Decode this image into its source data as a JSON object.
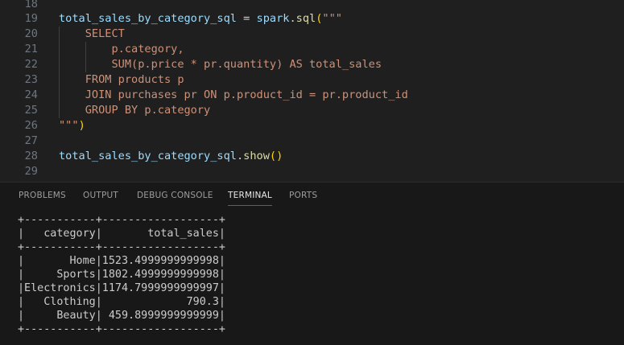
{
  "editor": {
    "lines": [
      {
        "n": "18",
        "tokens": []
      },
      {
        "n": "19",
        "tokens": [
          {
            "t": "total_sales_by_category_sql",
            "c": "var"
          },
          {
            "t": " = ",
            "c": "def"
          },
          {
            "t": "spark",
            "c": "var"
          },
          {
            "t": ".",
            "c": "def"
          },
          {
            "t": "sql",
            "c": "fn"
          },
          {
            "t": "(",
            "c": "br"
          },
          {
            "t": "\"\"\"",
            "c": "str"
          }
        ]
      },
      {
        "n": "20",
        "tokens": [
          {
            "t": "    SELECT",
            "c": "str"
          }
        ]
      },
      {
        "n": "21",
        "tokens": [
          {
            "t": "        p.category,",
            "c": "str"
          }
        ]
      },
      {
        "n": "22",
        "tokens": [
          {
            "t": "        SUM(p.price * pr.quantity) AS total_sales",
            "c": "str"
          }
        ]
      },
      {
        "n": "23",
        "tokens": [
          {
            "t": "    FROM products p",
            "c": "str"
          }
        ]
      },
      {
        "n": "24",
        "tokens": [
          {
            "t": "    JOIN purchases pr ON p.product_id = pr.product_id",
            "c": "str"
          }
        ]
      },
      {
        "n": "25",
        "tokens": [
          {
            "t": "    GROUP BY p.category",
            "c": "str"
          }
        ]
      },
      {
        "n": "26",
        "tokens": [
          {
            "t": "\"\"\"",
            "c": "str"
          },
          {
            "t": ")",
            "c": "br"
          }
        ]
      },
      {
        "n": "27",
        "tokens": []
      },
      {
        "n": "28",
        "tokens": [
          {
            "t": "total_sales_by_category_sql",
            "c": "var"
          },
          {
            "t": ".",
            "c": "def"
          },
          {
            "t": "show",
            "c": "fn"
          },
          {
            "t": "()",
            "c": "br"
          }
        ]
      },
      {
        "n": "29",
        "tokens": []
      }
    ]
  },
  "panel": {
    "tabs": [
      {
        "label": "PROBLEMS",
        "active": false
      },
      {
        "label": "OUTPUT",
        "active": false
      },
      {
        "label": "DEBUG CONSOLE",
        "active": false
      },
      {
        "label": "TERMINAL",
        "active": true
      },
      {
        "label": "PORTS",
        "active": false
      }
    ]
  },
  "terminal": {
    "lines": [
      "+-----------+------------------+",
      "|   category|       total_sales|",
      "+-----------+------------------+",
      "|       Home|1523.4999999999998|",
      "|     Sports|1802.4999999999998|",
      "|Electronics|1174.7999999999997|",
      "|   Clothing|             790.3|",
      "|     Beauty| 459.8999999999999|",
      "+-----------+------------------+"
    ]
  },
  "colors": {
    "variable": "#9cdcfe",
    "function": "#dcdcaa",
    "string": "#ce9178",
    "bracket": "#ffd700",
    "line_number": "#6e7681",
    "active_tab_underline": "#0078d4"
  }
}
